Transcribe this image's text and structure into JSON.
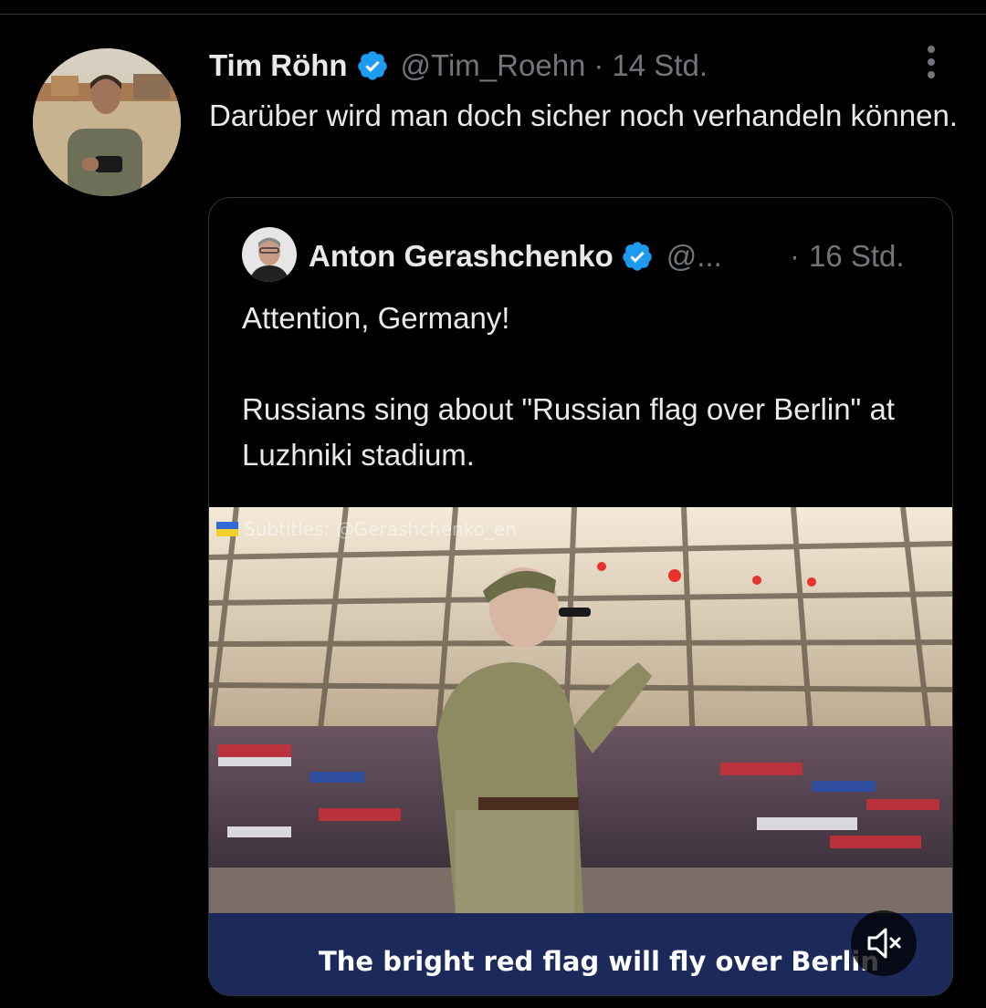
{
  "tweet": {
    "author_name": "Tim Röhn",
    "handle": "@Tim_Roehn",
    "separator": "·",
    "time": "14 Std.",
    "text": "Darüber wird man doch sicher noch verhandeln können."
  },
  "quote": {
    "author_name": "Anton Gerashchenko",
    "handle": "@...",
    "separator": "·",
    "time": "16 Std.",
    "text_line1": "Attention, Germany!",
    "text_line2": "Russians sing about \"Russian flag over Berlin\" at Luzhniki stadium.",
    "video": {
      "watermark": "Subtitles: @Gerashchenko_en",
      "subtitle": "The bright red flag will fly over Berlin"
    }
  },
  "icons": {
    "verified": "verified-badge-icon",
    "more": "more-options-icon",
    "mute": "muted-volume-icon"
  },
  "colors": {
    "background": "#000000",
    "text_primary": "#e7e9ea",
    "text_secondary": "#71767b",
    "verified": "#1d9bf0",
    "border": "#2f3336",
    "subtitle_bar": "#1b2a5a"
  }
}
